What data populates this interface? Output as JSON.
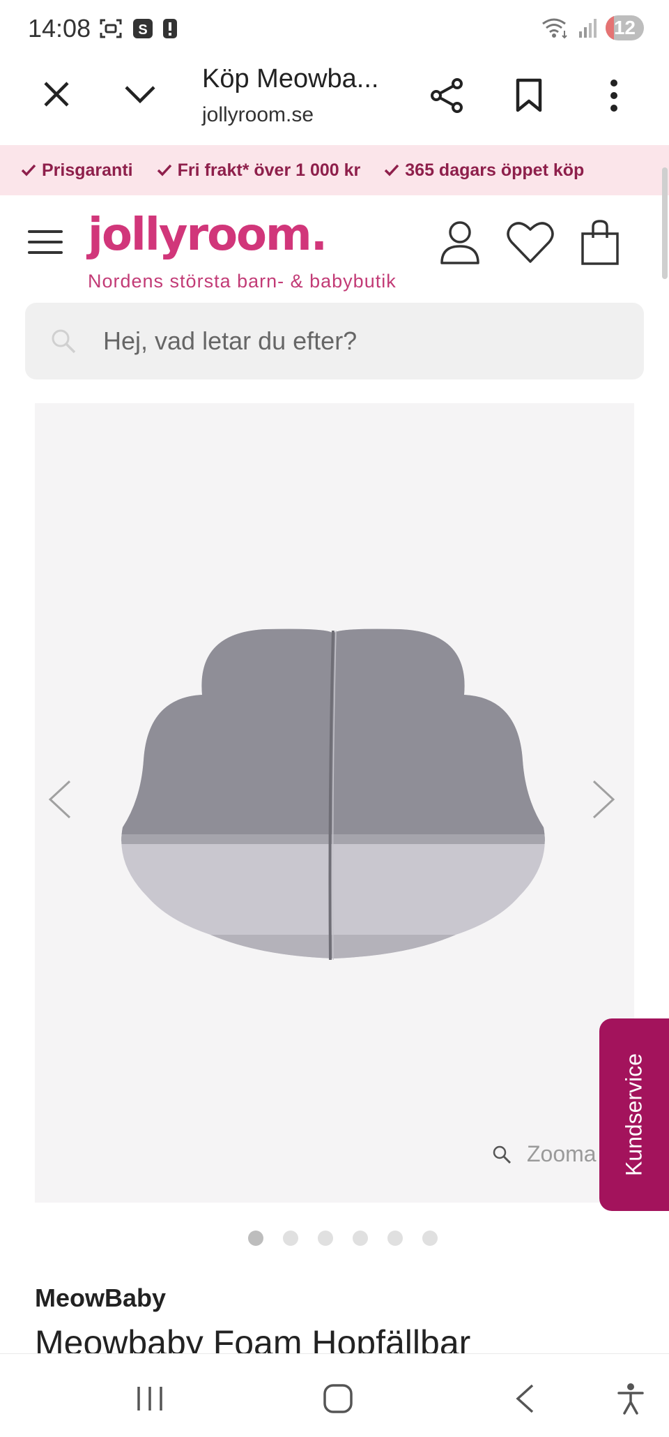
{
  "status_bar": {
    "time": "14:08",
    "battery_level": "12",
    "icons": [
      "screenshot-icon",
      "s-app-icon",
      "alert-icon",
      "wifi-icon",
      "signal-icon"
    ]
  },
  "browser": {
    "tab_title": "Köp Meowba...",
    "url": "jollyroom.se",
    "icons": [
      "close-icon",
      "chevron-down-icon",
      "share-icon",
      "bookmark-icon",
      "more-vert-icon"
    ]
  },
  "promo": {
    "items": [
      "Prisgaranti",
      "Fri frakt* över 1 000 kr",
      "365 dagars öppet köp"
    ],
    "color": "#8e1f4b",
    "background": "#fbe5ea"
  },
  "header": {
    "logo": "jollyroom.",
    "tagline": "Nordens största barn- & babybutik",
    "brand_color": "#d1367a"
  },
  "search": {
    "placeholder": "Hej, vad letar du efter?"
  },
  "gallery": {
    "zoom_label": "Zooma",
    "dot_count": 6,
    "active_index": 0
  },
  "kundservice": {
    "label": "Kundservice",
    "color": "#a3135c"
  },
  "product": {
    "brand": "MeowBaby",
    "title": "Meowbaby Foam Hopfällbar"
  }
}
